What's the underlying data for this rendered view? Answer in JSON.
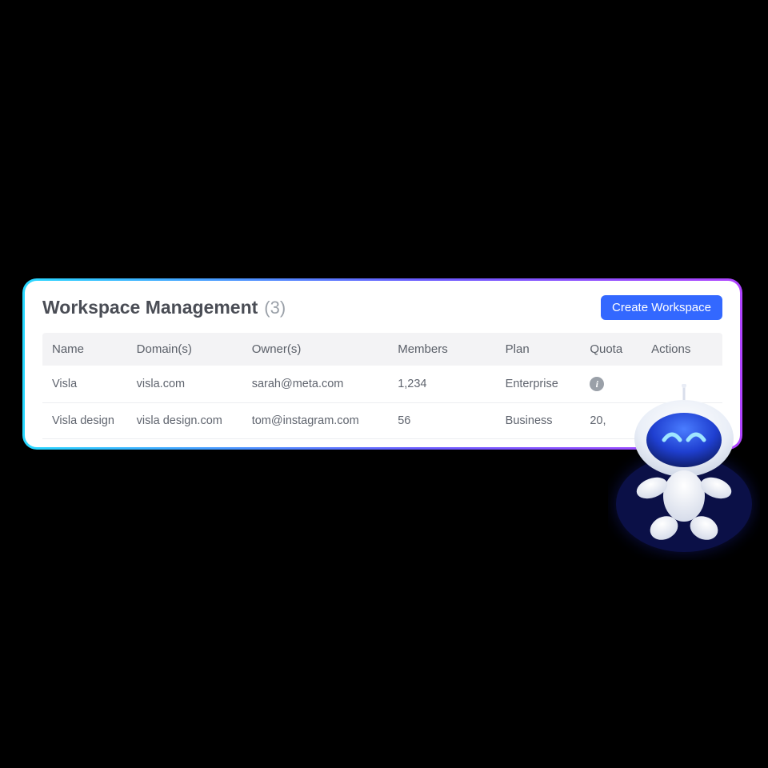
{
  "header": {
    "title": "Workspace Management",
    "count": "(3)",
    "create_button": "Create Workspace"
  },
  "table": {
    "columns": {
      "name": "Name",
      "domain": "Domain(s)",
      "owner": "Owner(s)",
      "members": "Members",
      "plan": "Plan",
      "quota": "Quota",
      "actions": "Actions"
    },
    "rows": [
      {
        "name": "Visla",
        "domain": "visla.com",
        "owner": "sarah@meta.com",
        "members": "1,234",
        "plan": "Enterprise",
        "quota": ""
      },
      {
        "name": "Visla design",
        "domain": "visla design.com",
        "owner": "tom@instagram.com",
        "members": "56",
        "plan": "Business",
        "quota": "20,"
      }
    ]
  }
}
